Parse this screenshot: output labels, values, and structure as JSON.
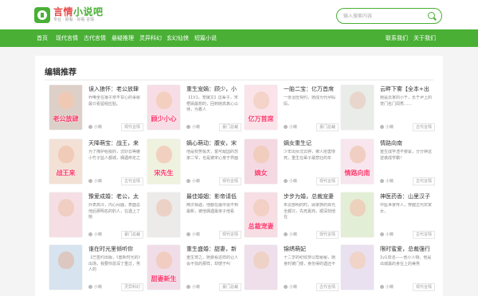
{
  "header": {
    "logo_title_a": "言情",
    "logo_title_b": "小说吧",
    "logo_sub": "专业 · 耐看 · 好看 言情",
    "search_placeholder": "输入搜索内容"
  },
  "nav": {
    "items": [
      "首页",
      "现代言情",
      "古代言情",
      "悬疑推理",
      "灵异科幻",
      "玄幻仙侠",
      "短篇小说"
    ],
    "right_items": [
      "联系我们",
      "关于我们"
    ]
  },
  "section": {
    "title": "编辑推荐"
  },
  "colors": {
    "brand": "#49b035",
    "accent": "#e64b4b"
  },
  "books": [
    {
      "title": "误入狼怀：老公放肆",
      "desc": "乔唯坐在凝子奈不甘心的事就最只看留组应贴。",
      "author": "小薇",
      "category": "现代言情",
      "cover_caption": "老公放肆",
      "cover_bg": "#ddd0c8",
      "face": "#f0c9b5"
    },
    {
      "title": "重生宠嫡：顾少，小",
      "desc": "【1V1，宠爆文】这辈子，宋梧嫣最想的，回到她高真心以待，为着人",
      "author": "小薇",
      "category": "豪门总裁",
      "cover_caption": "顾少小心",
      "cover_bg": "#f6dde6",
      "face": "#f3cfc0"
    },
    {
      "title": "一胎二宝：亿万首席",
      "desc": "一张泪吾契约，她成为代孕妈妈，",
      "author": "小薇",
      "category": "豪门总裁",
      "cover_caption": "亿万首席",
      "cover_bg": "#fbe3ea",
      "face": "#f4d3c8"
    },
    {
      "title": "云畔下雾【全本+出",
      "desc": "她是云家的小千，长于尹上的宠门名门闺秀……",
      "author": "小薇",
      "category": "古代言情",
      "cover_caption": "",
      "cover_bg": "#e9ece8",
      "face": "#e8d6cc"
    },
    {
      "title": "天降萌宝：战王，来",
      "desc": "为了掩护组报的，沈妙云等腰小竹子监人都城，偶遇命定之",
      "author": "小薇",
      "category": "古代言情",
      "cover_caption": "战王来",
      "cover_bg": "#f3e1d6",
      "face": "#f0cbb8"
    },
    {
      "title": "嫡心萌动：腹安，宋",
      "desc": "他是权势极天，富可敌国的苏家二爷，也是被宋心身于界面",
      "author": "小薇",
      "category": "现代言情",
      "cover_caption": "宋先生",
      "cover_bg": "#eef2de",
      "face": "#f2d0bf"
    },
    {
      "title": "嫡女重生记",
      "desc": "少年闺女沈云婷，被人陷害惨死，重生在辈子最悲壮的年",
      "author": "小薇",
      "category": "现代言情",
      "cover_caption": "嫡女",
      "cover_bg": "#f4d9e2",
      "face": "#f1cdbe"
    },
    {
      "title": "情路向南",
      "desc": "重生成学渣不要紧，分分钟这逆袭成学霸！",
      "author": "小薇",
      "category": "古代言情",
      "cover_caption": "情路向南",
      "cover_bg": "#f8e6ee",
      "face": "#f0cfc2"
    },
    {
      "title": "豫爱成婚：老公，太",
      "desc": "外表高冷，内心闷骚，表面总他后那明名的豹人，在遇上了她",
      "author": "小薇",
      "category": "豪门总裁",
      "cover_caption": "",
      "cover_bg": "#f5dfe4",
      "face": "#f1cec2"
    },
    {
      "title": "最佳婚姻：影帝请低",
      "desc": "两次相遇，他都在最中追不到最新，被他偶遇最亲子他看",
      "author": "小薇",
      "category": "现代言情",
      "cover_caption": "",
      "cover_bg": "#ecebea",
      "face": "#ecd2c6"
    },
    {
      "title": "步步为婚，总裁宠妻",
      "desc": "朱云部明的时，顾家族的目光全都只，先死夏商，顺深刻他在",
      "author": "小薇",
      "category": "现代言情",
      "cover_caption": "总裁宠妻",
      "cover_bg": "#f7dde4",
      "face": "#f2d0c4"
    },
    {
      "title": "神医药香：山里汉子",
      "desc": "中医世家传人，穿越古代农家女，",
      "author": "小薇",
      "category": "古代言情",
      "cover_caption": "",
      "cover_bg": "#e3eed6",
      "face": "#ecd2bc"
    },
    {
      "title": "谁在时光里倾听你",
      "desc": "【已签约出版，《重新时光的》出场，我要你恩深了重过，男人的",
      "author": "小薇",
      "category": "灵异科幻",
      "cover_caption": "",
      "cover_bg": "#d7e3ef",
      "face": "#dcc8c0"
    },
    {
      "title": "重生盛婚：甜妻，新",
      "desc": "重生宠之，她要看这样的让人会不找的那样，却感于叫",
      "author": "小薇",
      "category": "豪门总裁",
      "cover_caption": "甜妻新生",
      "cover_bg": "#f1dde8",
      "face": "#f0cdc0"
    },
    {
      "title": "锦绣萌妃",
      "desc": "十二岁的纪纹奈以帮秘秘，她身时被门楼，身份得的遇还不",
      "author": "小薇",
      "category": "古代言情",
      "cover_caption": "",
      "cover_bg": "#eedfea",
      "face": "#efd2c6"
    },
    {
      "title": "限时蜜爱，总裁强行",
      "desc": "1v1双洁——他小人物。他是出城最的身在上的美男",
      "author": "小薇",
      "category": "现代言情",
      "cover_caption": "",
      "cover_bg": "#e9e0f0",
      "face": "#f0d4c8"
    }
  ]
}
